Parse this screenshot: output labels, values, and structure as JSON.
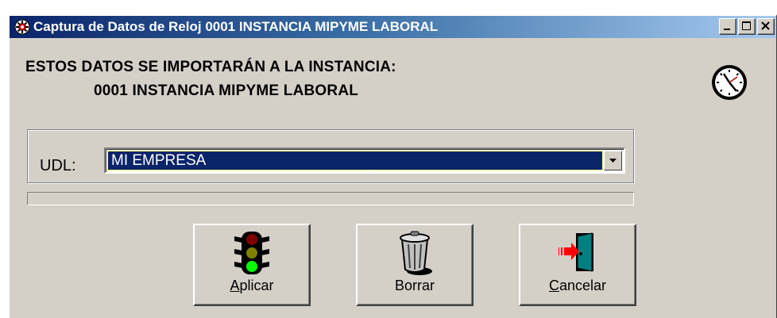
{
  "window": {
    "title": "Captura de Datos de Reloj 0001 INSTANCIA MIPYME LABORAL",
    "title_icon": "app-gear-icon",
    "controls": [
      "minimize-icon",
      "maximize-icon",
      "close-icon"
    ]
  },
  "header": {
    "line1": "ESTOS DATOS SE IMPORTARÁN A LA INSTANCIA:",
    "line2": "0001 INSTANCIA MIPYME LABORAL",
    "icon": "clock-icon"
  },
  "udl": {
    "label": "UDL:",
    "selected": "MI EMPRESA"
  },
  "progress": {
    "value": 0
  },
  "buttons": {
    "apply": {
      "accel": "A",
      "rest": "plicar",
      "icon": "traffic-light-icon"
    },
    "clear": {
      "label": "Borrar",
      "icon": "trash-can-icon"
    },
    "cancel": {
      "accel": "C",
      "rest": "ancelar",
      "icon": "exit-door-icon"
    }
  },
  "colors": {
    "face": "#d4d0c8",
    "title_start": "#0a246a",
    "title_end": "#a6caf0",
    "selection": "#0a246a"
  }
}
